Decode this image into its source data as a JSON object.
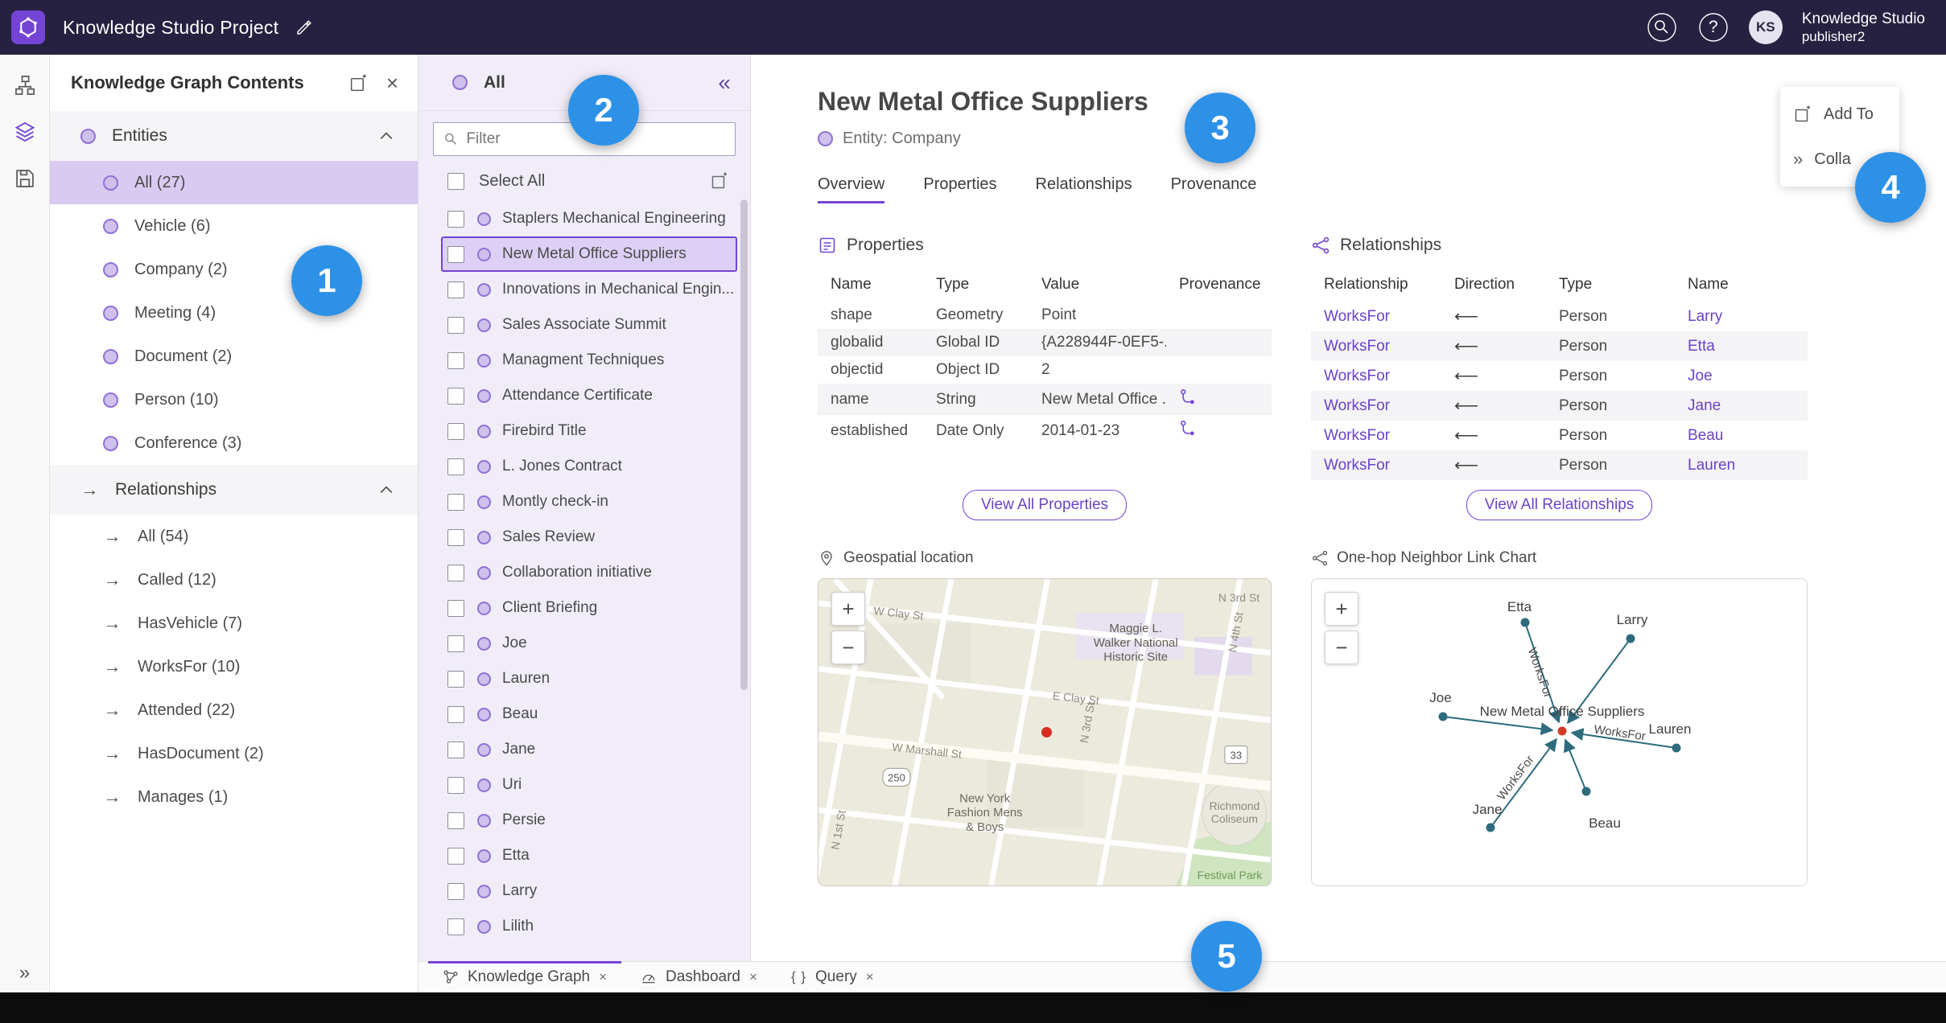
{
  "colors": {
    "accent_purple": "#7445d4",
    "topbar_bg": "#262140",
    "annotation_blue": "#2d91e8",
    "graph_teal": "#2d6b7d",
    "marker_red": "#d13b26"
  },
  "icons": {
    "help_glyph": "?",
    "close_glyph": "×",
    "collapse_left_glyph": "«",
    "expand_right_glyph": "»",
    "zoom_in_glyph": "+",
    "zoom_out_glyph": "−",
    "arrow_right_glyph": "→",
    "query_glyph": "{ }"
  },
  "topbar": {
    "project_title": "Knowledge Studio Project",
    "user_name": "Knowledge Studio",
    "user_role": "publisher2",
    "avatar_initials": "KS"
  },
  "contents_panel": {
    "title": "Knowledge Graph Contents",
    "sections": {
      "entities": {
        "label": "Entities",
        "items": [
          {
            "label": "All (27)"
          },
          {
            "label": "Vehicle (6)"
          },
          {
            "label": "Company (2)"
          },
          {
            "label": "Meeting (4)"
          },
          {
            "label": "Document (2)"
          },
          {
            "label": "Person (10)"
          },
          {
            "label": "Conference (3)"
          }
        ]
      },
      "relationships": {
        "label": "Relationships",
        "items": [
          {
            "label": "All (54)"
          },
          {
            "label": "Called (12)"
          },
          {
            "label": "HasVehicle (7)"
          },
          {
            "label": "WorksFor (10)"
          },
          {
            "label": "Attended (22)"
          },
          {
            "label": "HasDocument (2)"
          },
          {
            "label": "Manages (1)"
          }
        ]
      }
    }
  },
  "list_panel": {
    "header_label": "All",
    "filter_placeholder": "Filter",
    "select_all_label": "Select All",
    "items": [
      {
        "label": "Staplers Mechanical Engineering"
      },
      {
        "label": "New Metal Office Suppliers"
      },
      {
        "label": "Innovations in Mechanical Engin..."
      },
      {
        "label": "Sales Associate Summit"
      },
      {
        "label": "Managment Techniques"
      },
      {
        "label": "Attendance Certificate"
      },
      {
        "label": "Firebird Title"
      },
      {
        "label": "L. Jones Contract"
      },
      {
        "label": "Montly check-in"
      },
      {
        "label": "Sales Review"
      },
      {
        "label": "Collaboration initiative"
      },
      {
        "label": "Client Briefing"
      },
      {
        "label": "Joe"
      },
      {
        "label": "Lauren"
      },
      {
        "label": "Beau"
      },
      {
        "label": "Jane"
      },
      {
        "label": "Uri"
      },
      {
        "label": "Persie"
      },
      {
        "label": "Etta"
      },
      {
        "label": "Larry"
      },
      {
        "label": "Lilith"
      }
    ]
  },
  "detail": {
    "title": "New Metal Office Suppliers",
    "entity_type_label": "Entity: Company",
    "tabs": [
      {
        "label": "Overview"
      },
      {
        "label": "Properties"
      },
      {
        "label": "Relationships"
      },
      {
        "label": "Provenance"
      }
    ],
    "actions": {
      "add_to": "Add To",
      "collapse": "Colla"
    },
    "properties": {
      "title": "Properties",
      "columns": [
        "Name",
        "Type",
        "Value",
        "Provenance"
      ],
      "rows": [
        {
          "name": "shape",
          "type": "Geometry",
          "value": "Point"
        },
        {
          "name": "globalid",
          "type": "Global ID",
          "value": "{A228944F-0EF5-..."
        },
        {
          "name": "objectid",
          "type": "Object ID",
          "value": "2"
        },
        {
          "name": "name",
          "type": "String",
          "value": "New Metal Office ..."
        },
        {
          "name": "established",
          "type": "Date Only",
          "value": "2014-01-23"
        }
      ],
      "view_all_label": "View All Properties"
    },
    "relationships": {
      "title": "Relationships",
      "columns": [
        "Relationship",
        "Direction",
        "Type",
        "Name"
      ],
      "direction_arrow": "⟵",
      "rows": [
        {
          "relationship": "WorksFor",
          "type": "Person",
          "name": "Larry"
        },
        {
          "relationship": "WorksFor",
          "type": "Person",
          "name": "Etta"
        },
        {
          "relationship": "WorksFor",
          "type": "Person",
          "name": "Joe"
        },
        {
          "relationship": "WorksFor",
          "type": "Person",
          "name": "Jane"
        },
        {
          "relationship": "WorksFor",
          "type": "Person",
          "name": "Beau"
        },
        {
          "relationship": "WorksFor",
          "type": "Person",
          "name": "Lauren"
        }
      ],
      "view_all_label": "View All Relationships"
    },
    "map": {
      "title": "Geospatial location",
      "streets": {
        "w_clay": "W Clay St",
        "e_clay": "E Clay St",
        "n_3rd_top": "N 3rd St",
        "n_3rd": "N 3rd St",
        "n_4th": "N 4th St",
        "w_marshall": "W Marshall St",
        "n_1st": "N 1st St"
      },
      "shields": {
        "us250": "250",
        "va33": "33"
      },
      "pois": {
        "maggie_1": "Maggie L.",
        "maggie_2": "Walker National",
        "maggie_3": "Historic Site",
        "fashion_1": "New York",
        "fashion_2": "Fashion Mens",
        "fashion_3": "& Boys",
        "coliseum_1": "Richmond",
        "coliseum_2": "Coliseum",
        "park": "Festival Park"
      }
    },
    "link_chart": {
      "title": "One-hop Neighbor Link Chart",
      "center_label": "New Metal Office Suppliers",
      "edge_label": "WorksFor",
      "nodes": [
        "Etta",
        "Larry",
        "Joe",
        "Lauren",
        "Jane",
        "Beau"
      ]
    }
  },
  "bottom_tabs": [
    {
      "label": "Knowledge Graph"
    },
    {
      "label": "Dashboard"
    },
    {
      "label": "Query"
    }
  ],
  "annotations": {
    "n1": "1",
    "n2": "2",
    "n3": "3",
    "n4": "4",
    "n5": "5"
  }
}
